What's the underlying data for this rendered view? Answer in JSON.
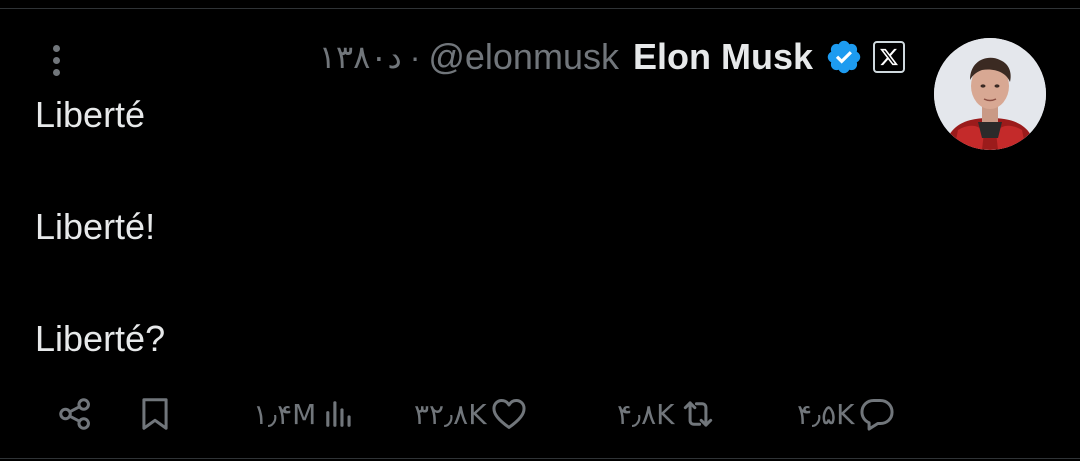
{
  "tweet": {
    "author": {
      "name": "Elon Musk",
      "handle": "@elonmusk",
      "avatar_icon": "elon-musk-profile-photo"
    },
    "time": "۱۳۸۰د",
    "time_separator": "·",
    "badges": [
      "verified-check-icon",
      "x-affiliation-icon"
    ],
    "lines": [
      "Liberté",
      "Liberté!",
      "Liberté?"
    ]
  },
  "actions": {
    "views": "۱٫۴M",
    "likes": "۳۲٫۸K",
    "reposts": "۴٫۸K",
    "replies": "۴٫۵K"
  },
  "colors": {
    "background": "#000000",
    "text_primary": "#e7e9ea",
    "text_secondary": "#71767b",
    "verified_blue": "#1d9bf0"
  }
}
